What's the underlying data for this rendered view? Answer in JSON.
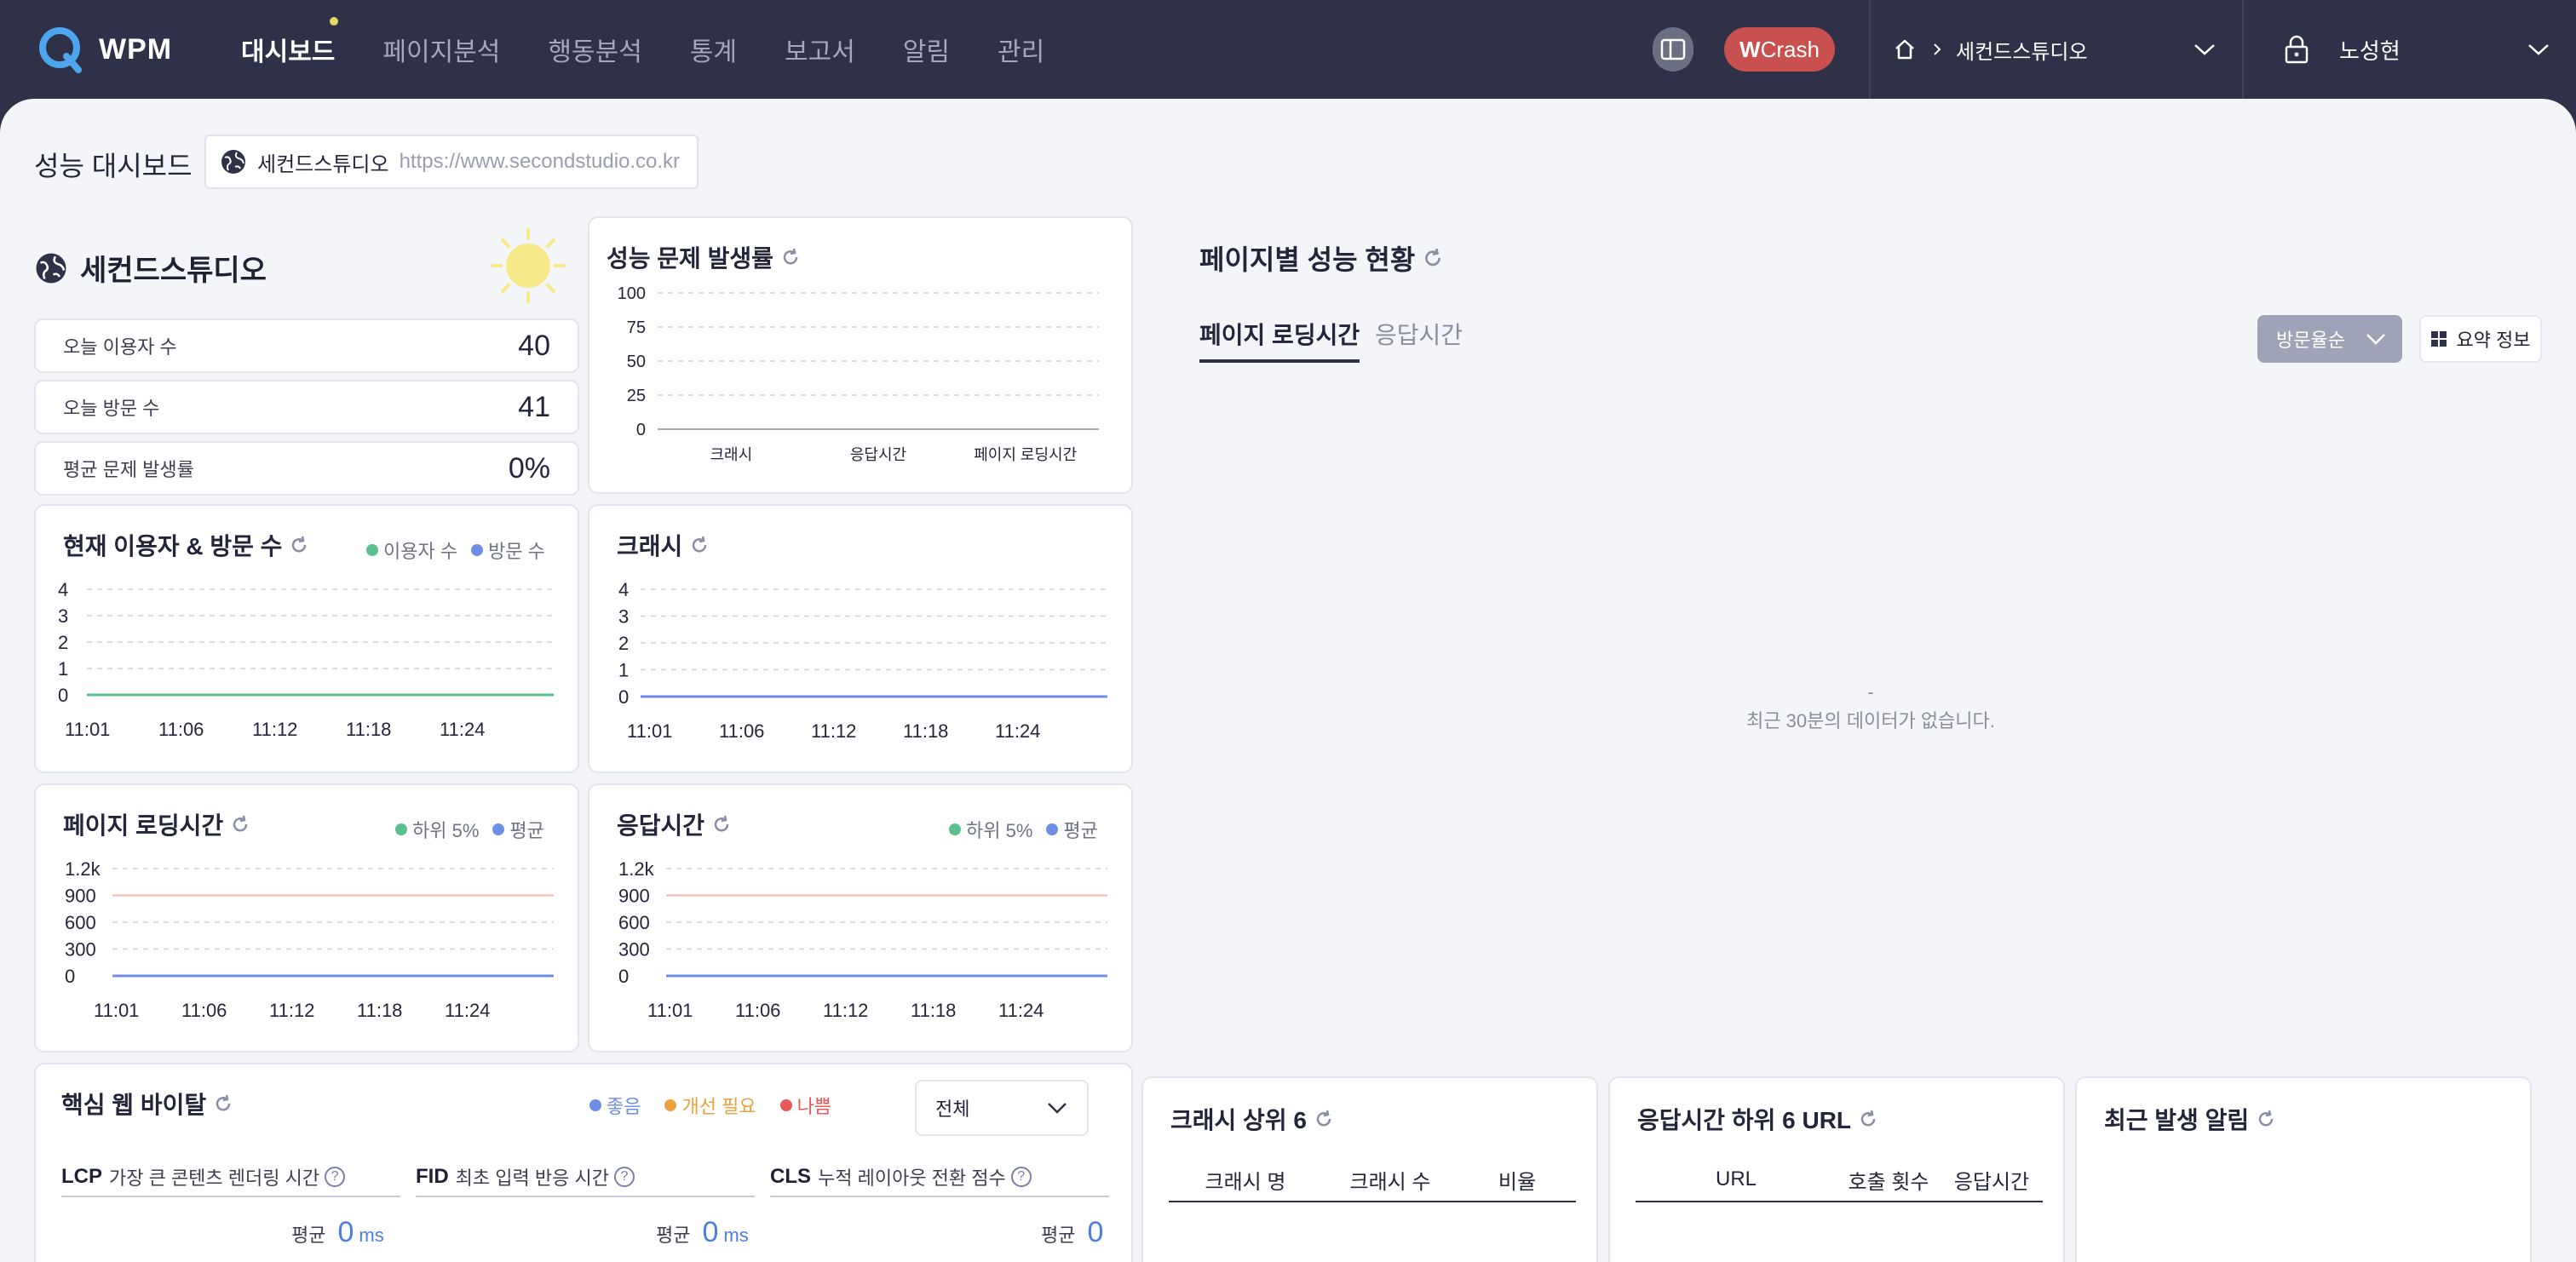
{
  "app": {
    "logo_text": "WPM"
  },
  "nav": {
    "items": [
      "대시보드",
      "페이지분석",
      "행동분석",
      "통계",
      "보고서",
      "알림",
      "관리"
    ],
    "active": "대시보드"
  },
  "header": {
    "wcrash_bold": "W",
    "wcrash_rest": "Crash",
    "site_selector": "세컨드스튜디오",
    "user_name": "노성현"
  },
  "page": {
    "title": "성능 대시보드",
    "site_name": "세컨드스튜디오",
    "site_url": "https://www.secondstudio.co.kr"
  },
  "summary": {
    "site_title": "세컨드스튜디오",
    "weather_icon": "sun-icon",
    "stats": [
      {
        "label": "오늘 이용자 수",
        "value": "40"
      },
      {
        "label": "오늘 방문 수",
        "value": "41"
      },
      {
        "label": "평균 문제 발생률",
        "value": "0%"
      }
    ]
  },
  "issue_rate": {
    "title": "성능 문제 발생률",
    "chart_data": {
      "type": "bar",
      "categories": [
        "크래시",
        "응답시간",
        "페이지 로딩시간"
      ],
      "values": [
        0,
        0,
        0
      ],
      "yticks": [
        "100",
        "75",
        "50",
        "25",
        "0"
      ],
      "ylim": [
        0,
        100
      ]
    }
  },
  "current_users": {
    "title": "현재 이용자 & 방문 수",
    "legend": [
      {
        "label": "이용자 수",
        "color": "#5bbf8f"
      },
      {
        "label": "방문 수",
        "color": "#6f8fe6"
      }
    ],
    "chart_data": {
      "type": "line",
      "x": [
        "11:01",
        "11:06",
        "11:12",
        "11:18",
        "11:24"
      ],
      "yticks": [
        "4",
        "3",
        "2",
        "1",
        "0"
      ],
      "ylim": [
        0,
        4
      ],
      "series": [
        {
          "name": "이용자 수",
          "values": [
            0,
            0,
            0,
            0,
            0
          ]
        },
        {
          "name": "방문 수",
          "values": [
            0,
            0,
            0,
            0,
            0
          ]
        }
      ]
    }
  },
  "crash": {
    "title": "크래시",
    "chart_data": {
      "type": "line",
      "x": [
        "11:01",
        "11:06",
        "11:12",
        "11:18",
        "11:24"
      ],
      "yticks": [
        "4",
        "3",
        "2",
        "1",
        "0"
      ],
      "ylim": [
        0,
        4
      ],
      "series": [
        {
          "values": [
            0,
            0,
            0,
            0,
            0
          ]
        }
      ]
    }
  },
  "page_loading": {
    "title": "페이지 로딩시간",
    "legend": [
      {
        "label": "하위 5%",
        "color": "#5bbf8f"
      },
      {
        "label": "평균",
        "color": "#6f8fe6"
      }
    ],
    "chart_data": {
      "type": "line",
      "x": [
        "11:01",
        "11:06",
        "11:12",
        "11:18",
        "11:24"
      ],
      "yticks": [
        "1.2k",
        "900",
        "600",
        "300",
        "0"
      ],
      "ylim": [
        0,
        1200
      ],
      "threshold": 900,
      "series": [
        {
          "name": "하위 5%",
          "values": [
            0,
            0,
            0,
            0,
            0
          ]
        },
        {
          "name": "평균",
          "values": [
            0,
            0,
            0,
            0,
            0
          ]
        }
      ]
    }
  },
  "response_time": {
    "title": "응답시간",
    "legend": [
      {
        "label": "하위 5%",
        "color": "#5bbf8f"
      },
      {
        "label": "평균",
        "color": "#6f8fe6"
      }
    ],
    "chart_data": {
      "type": "line",
      "x": [
        "11:01",
        "11:06",
        "11:12",
        "11:18",
        "11:24"
      ],
      "yticks": [
        "1.2k",
        "900",
        "600",
        "300",
        "0"
      ],
      "ylim": [
        0,
        1200
      ],
      "threshold": 900,
      "series": [
        {
          "name": "하위 5%",
          "values": [
            0,
            0,
            0,
            0,
            0
          ]
        },
        {
          "name": "평균",
          "values": [
            0,
            0,
            0,
            0,
            0
          ]
        }
      ]
    }
  },
  "page_perf": {
    "title": "페이지별 성능 현황",
    "tabs": [
      "페이지 로딩시간",
      "응답시간"
    ],
    "sort_label": "방문율순",
    "summary_btn": "요약 정보",
    "empty_dash": "-",
    "empty_msg": "최근 30분의 데이터가 없습니다."
  },
  "cwv": {
    "title": "핵심 웹 바이탈",
    "legend": [
      {
        "label": "좋음",
        "color": "#6f8fe6"
      },
      {
        "label": "개선 필요",
        "color": "#e8a33c"
      },
      {
        "label": "나쁨",
        "color": "#e85a5a"
      }
    ],
    "filter": "전체",
    "items": [
      {
        "key": "LCP",
        "desc": "가장 큰 콘텐츠 렌더링 시간",
        "avg_label": "평균",
        "value": "0",
        "unit": "ms"
      },
      {
        "key": "FID",
        "desc": "최초 입력 반응 시간",
        "avg_label": "평균",
        "value": "0",
        "unit": "ms"
      },
      {
        "key": "CLS",
        "desc": "누적 레이아웃 전환 점수",
        "avg_label": "평균",
        "value": "0",
        "unit": ""
      }
    ]
  },
  "crash_top": {
    "title": "크래시 상위 6",
    "columns": [
      "크래시 명",
      "크래시 수",
      "비율"
    ]
  },
  "resp_bottom": {
    "title": "응답시간 하위 6 URL",
    "columns": [
      "URL",
      "호출 횟수",
      "응답시간"
    ]
  },
  "recent_alerts": {
    "title": "최근 발생 알림"
  }
}
